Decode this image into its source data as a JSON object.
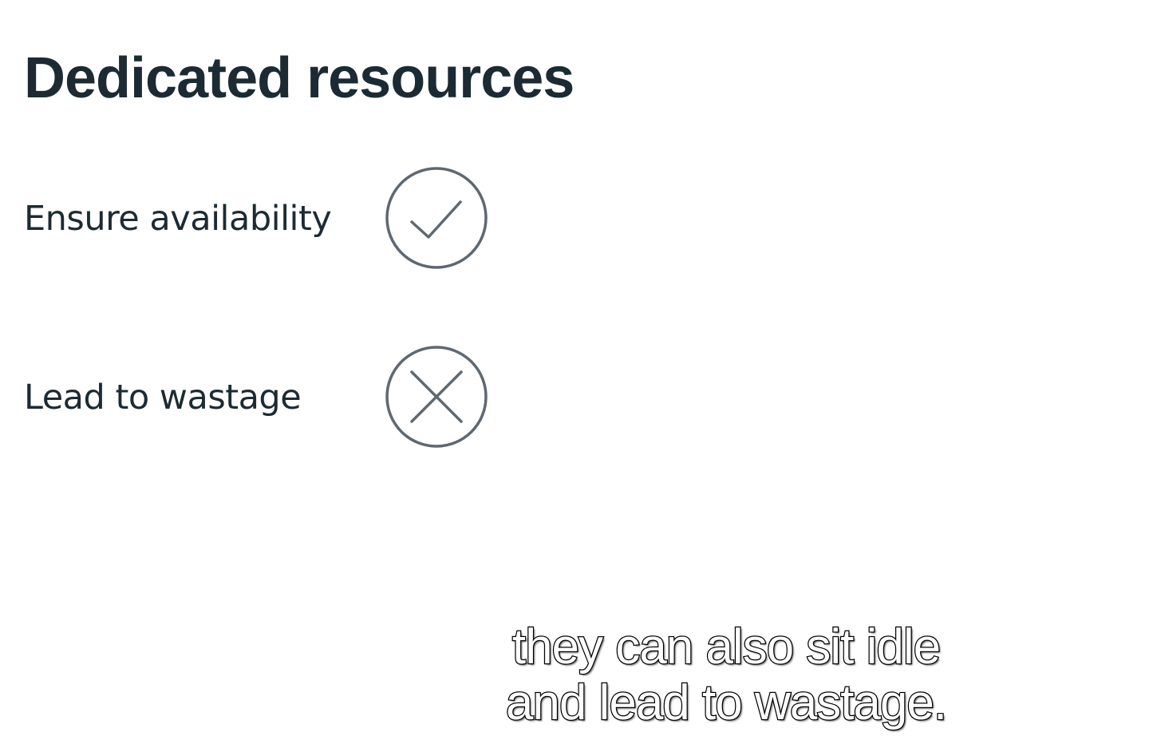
{
  "slide": {
    "title": "Dedicated resources",
    "items": [
      {
        "label": "Ensure availability",
        "icon": "check-circle-icon"
      },
      {
        "label": "Lead to wastage",
        "icon": "x-circle-icon"
      }
    ]
  },
  "subtitle": {
    "line1": "they can also sit idle",
    "line2": "and lead to wastage."
  },
  "colors": {
    "text": "#1c2b33",
    "icon_stroke": "#5f6870",
    "background": "#ffffff"
  }
}
